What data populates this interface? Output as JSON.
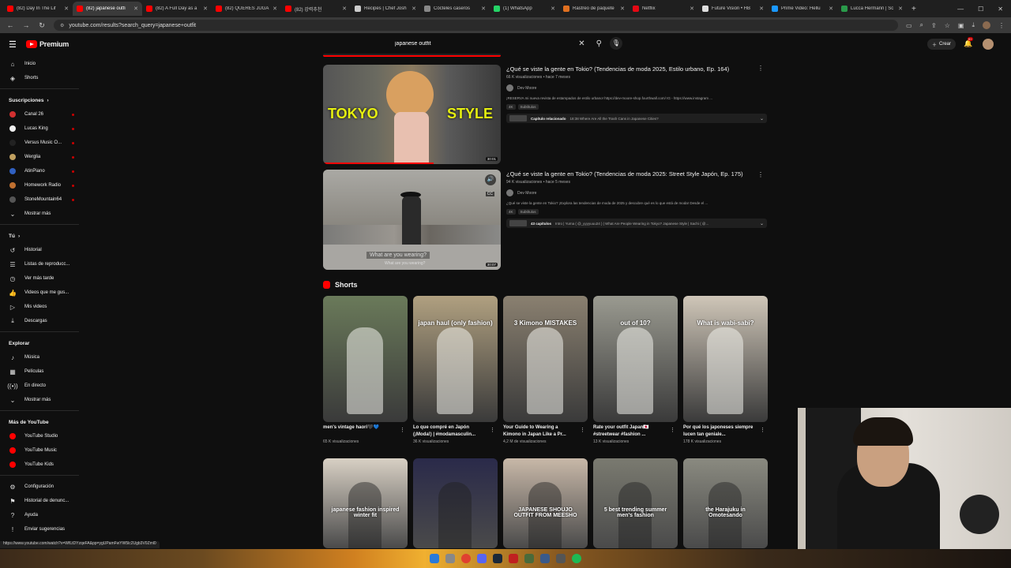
{
  "browser": {
    "tabs": [
      {
        "label": "(82) Day In The Lif",
        "color": "#ff0000",
        "active": false
      },
      {
        "label": "(82) japanese outfi",
        "color": "#ff0000",
        "active": true
      },
      {
        "label": "(82) A Full Day as a",
        "color": "#ff0000",
        "active": false
      },
      {
        "label": "(82) QUERÉS JUGA",
        "color": "#ff0000",
        "active": false
      },
      {
        "label": "(82) 강력추천",
        "color": "#ff0000",
        "active": false
      },
      {
        "label": "Recipes | Chef Josh",
        "color": "#cccccc",
        "active": false
      },
      {
        "label": "Cócteles caseros",
        "color": "#888888",
        "active": false
      },
      {
        "label": "(1) WhatsApp",
        "color": "#25d366",
        "active": false
      },
      {
        "label": "Rastreo de paquete",
        "color": "#e07020",
        "active": false
      },
      {
        "label": "Netflix",
        "color": "#e50914",
        "active": false
      },
      {
        "label": "Future Vision • HB",
        "color": "#dddddd",
        "active": false
      },
      {
        "label": "Prime Video: Hellu",
        "color": "#1a98ff",
        "active": false
      },
      {
        "label": "Lucca Hermann | Sc",
        "color": "#2a9a4a",
        "active": false
      }
    ],
    "url": "youtube.com/results?search_query=japanese+outfit",
    "status_url": "https://www.youtube.com/watch?v=WfLtDYzqeFA&pp=ygUPamFwYW5lc2Ugb3V0Zml0"
  },
  "header": {
    "logo_text": "Premium",
    "search_value": "japanese outfit",
    "create_label": "Crear",
    "notif_badge": "9+"
  },
  "sidebar": {
    "main": [
      {
        "label": "Inicio",
        "icon": "home-icon",
        "glyph": "⌂"
      },
      {
        "label": "Shorts",
        "icon": "shorts-icon",
        "glyph": "◈"
      }
    ],
    "subs_title": "Suscripciones",
    "subs": [
      {
        "label": "Canal 26",
        "color": "#d23030"
      },
      {
        "label": "Lucas King",
        "color": "#eeeeee"
      },
      {
        "label": "Versus Music O...",
        "color": "#222222"
      },
      {
        "label": "Werglia",
        "color": "#c0a060"
      },
      {
        "label": "AtinPiano",
        "color": "#3060c0"
      },
      {
        "label": "Homework Radio",
        "color": "#c07030"
      },
      {
        "label": "StoneMountain64",
        "color": "#555555"
      }
    ],
    "subs_more": "Mostrar más",
    "you_title": "Tú",
    "you": [
      {
        "label": "Historial",
        "icon": "history-icon",
        "glyph": "↺"
      },
      {
        "label": "Listas de reproducc...",
        "icon": "playlists-icon",
        "glyph": "☰"
      },
      {
        "label": "Ver más tarde",
        "icon": "watch-later-icon",
        "glyph": "◷"
      },
      {
        "label": "Videos que me gus...",
        "icon": "like-icon",
        "glyph": "👍"
      },
      {
        "label": "Mis videos",
        "icon": "my-videos-icon",
        "glyph": "▷"
      },
      {
        "label": "Descargas",
        "icon": "downloads-icon",
        "glyph": "⤓"
      }
    ],
    "explore_title": "Explorar",
    "explore": [
      {
        "label": "Música",
        "icon": "music-icon",
        "glyph": "♪"
      },
      {
        "label": "Películas",
        "icon": "movies-icon",
        "glyph": "▦"
      },
      {
        "label": "En directo",
        "icon": "live-icon",
        "glyph": "((•))"
      },
      {
        "label": "Mostrar más",
        "icon": "chevron-down-icon",
        "glyph": "⌄"
      }
    ],
    "more_title": "Más de YouTube",
    "more": [
      {
        "label": "YouTube Studio",
        "color": "#ff0000"
      },
      {
        "label": "YouTube Music",
        "color": "#ff0000"
      },
      {
        "label": "YouTube Kids",
        "color": "#ff0000"
      }
    ],
    "bottom": [
      {
        "label": "Configuración",
        "icon": "settings-icon",
        "glyph": "⚙"
      },
      {
        "label": "Historial de denunc...",
        "icon": "flag-icon",
        "glyph": "⚑"
      },
      {
        "label": "Ayuda",
        "icon": "help-icon",
        "glyph": "?"
      },
      {
        "label": "Enviar sugerencias",
        "icon": "feedback-icon",
        "glyph": "!"
      }
    ]
  },
  "results": [
    {
      "title": "¿Qué se viste la gente en Tokio? (Tendencias de moda 2025, Estilo urbano, Ep. 164)",
      "meta": "66 K visualizaciones • hace 7 meses",
      "channel": "Dev Moore",
      "desc": "¡RESERVA mi nueva revista de estampados de estilo urbano! https://dev-moore-shop.fourthwall.com/ IG - https://www.instagram ...",
      "badges": [
        "4K",
        "Subtítulos"
      ],
      "chapter_bold": "Capítulo relacionado",
      "chapter_text": "18:38 Where Are All the Trash Cans in Japanese Cities?",
      "duration": "30:01",
      "overlay_left": "TOKYO",
      "overlay_right": "STYLE",
      "progress": 0.62
    },
    {
      "title": "¿Qué se viste la gente en Tokio? (Tendencias de moda 2025: Street Style Japón, Ep. 175)",
      "meta": "94 K visualizaciones • hace 5 meses",
      "channel": "Dev Moore",
      "desc": "¿Qué se viste la gente en Tokio? ¡Explora las tendencias de moda de 2025 y descubre qué es lo que está de moda! Desde el ...",
      "badges": [
        "4K",
        "Subtítulos"
      ],
      "chapter_bold": "43 capítulos",
      "chapter_text": "Intro | Yuma ( @_yyyyuuu24 ) | What Are People Wearing in Tokyo? Japanese Style | Sachi ( @...",
      "duration": "30:07",
      "caption_1": "What are you wearing?",
      "caption_2": "What are you wearing?"
    }
  ],
  "shorts": {
    "title": "Shorts",
    "row1": [
      {
        "title": "men's vintage haori🖤💙",
        "views": "65 K visualizaciones",
        "bg": "#6a7a5a",
        "overlay": ""
      },
      {
        "title": "Lo que compré en Japón (¡Moda!) | #modamasculin...",
        "views": "36 K visualizaciones",
        "bg": "#b0a080",
        "overlay": "japan haul (only fashion)"
      },
      {
        "title": "Your Guide to Wearing a Kimono in Japan Like a Pr...",
        "views": "4,2 M de visualizaciones",
        "bg": "#8a8070",
        "overlay": "3 Kimono MISTAKES"
      },
      {
        "title": "Rate your outfit Japan🇯🇵 #streetwear #fashion ...",
        "views": "13 K visualizaciones",
        "bg": "#9a9a90",
        "overlay": "out of 10?"
      },
      {
        "title": "Por qué los japoneses siempre lucen tan geniale...",
        "views": "178 K visualizaciones",
        "bg": "#cfc6b8",
        "overlay": "What is wabi-sabi?"
      }
    ],
    "row2": [
      {
        "bg": "#d8d0c4",
        "overlay": "japanese fashion inspired winter fit"
      },
      {
        "bg": "#2a2a4a",
        "overlay": ""
      },
      {
        "bg": "#c8b8a8",
        "overlay": "JAPANESE SHOUJO OUTFIT FROM MEESHO"
      },
      {
        "bg": "#7a7a70",
        "overlay": "5 best trending summer men's fashion"
      },
      {
        "bg": "#8a8a80",
        "overlay": "the Harajuku in Omotesando"
      }
    ]
  }
}
